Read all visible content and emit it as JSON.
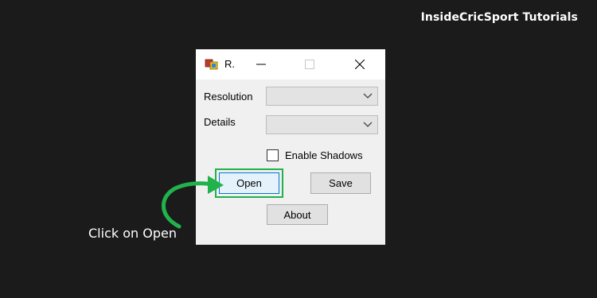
{
  "overlay": {
    "brand": "InsideCricSport Tutorials",
    "instruction": "Click on Open",
    "accent_color": "#22b24c"
  },
  "window": {
    "title": "R.",
    "icon": "app-window-icon",
    "controls": {
      "minimize": "minimize-icon",
      "maximize": "maximize-icon",
      "close": "close-icon"
    },
    "fields": {
      "resolution_label": "Resolution",
      "resolution_value": "",
      "details_label": "Details",
      "details_value": ""
    },
    "enable_shadows": {
      "label": "Enable Shadows",
      "checked": false
    },
    "buttons": {
      "open": "Open",
      "save": "Save",
      "about": "About"
    }
  }
}
